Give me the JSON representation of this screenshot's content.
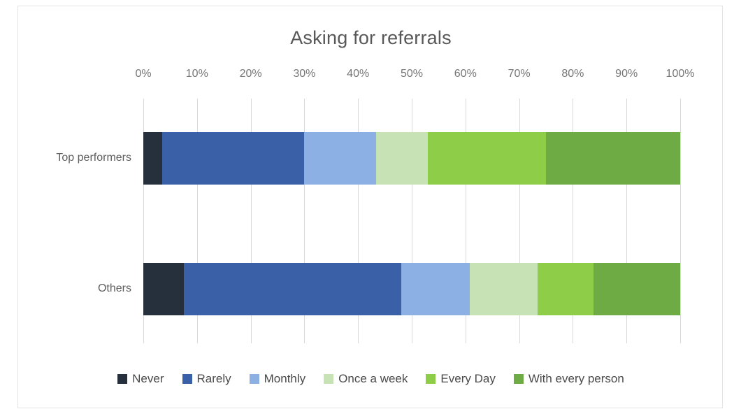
{
  "chart_data": {
    "type": "bar",
    "orientation": "horizontal",
    "stacked": true,
    "normalized": "100%",
    "title": "Asking for referrals",
    "xlabel": "",
    "ylabel": "",
    "xlim": [
      0,
      100
    ],
    "grid": true,
    "legend_position": "bottom",
    "categories": [
      "Top performers",
      "Others"
    ],
    "tick_labels": [
      "0%",
      "10%",
      "20%",
      "30%",
      "40%",
      "50%",
      "60%",
      "70%",
      "80%",
      "90%",
      "100%"
    ],
    "tick_values": [
      0,
      10,
      20,
      30,
      40,
      50,
      60,
      70,
      80,
      90,
      100
    ],
    "series": [
      {
        "name": "Never",
        "color": "#262f3c",
        "values": [
          3.5,
          7.5
        ]
      },
      {
        "name": "Rarely",
        "color": "#3a61a8",
        "values": [
          26.5,
          40.6
        ]
      },
      {
        "name": "Monthly",
        "color": "#8cb0e3",
        "values": [
          13.3,
          12.7
        ]
      },
      {
        "name": "Once a week",
        "color": "#c7e2b5",
        "values": [
          9.7,
          12.6
        ]
      },
      {
        "name": "Every Day",
        "color": "#8dcd47",
        "values": [
          22.0,
          10.4
        ]
      },
      {
        "name": "With every person",
        "color": "#6fab45",
        "values": [
          25.0,
          16.2
        ]
      }
    ]
  }
}
